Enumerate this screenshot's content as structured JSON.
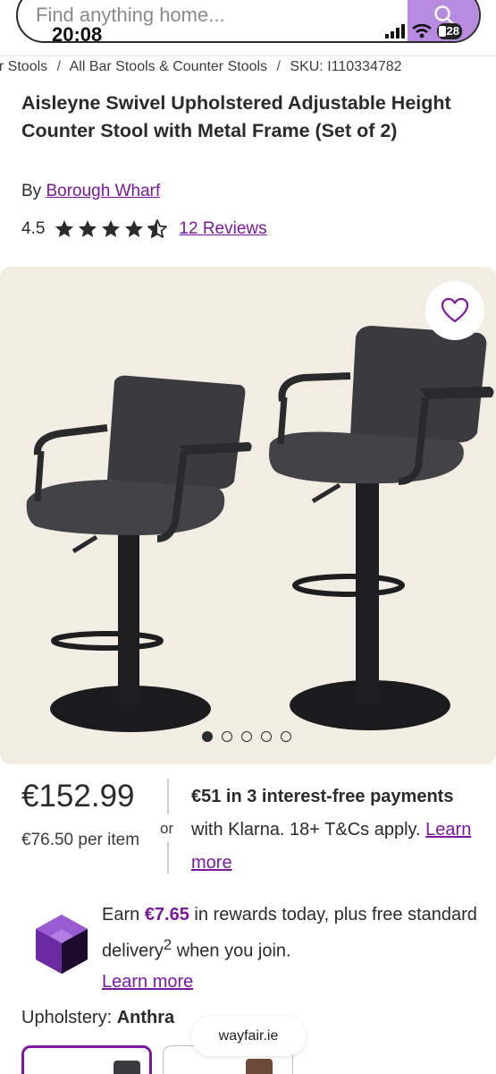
{
  "search": {
    "placeholder": "Find anything home..."
  },
  "status_bar": {
    "time": "20:08",
    "battery": "28"
  },
  "breadcrumb": {
    "items": [
      "er Stools",
      "All Bar Stools & Counter Stools",
      "SKU: I110334782"
    ],
    "separator": "/"
  },
  "product": {
    "title": "Aisleyne Swivel Upholstered Adjustable Height Counter Stool with Metal Frame (Set of 2)",
    "by_prefix": "By",
    "brand": "Borough Wharf",
    "rating": "4.5",
    "stars": 4.5,
    "reviews_link": "12 Reviews"
  },
  "gallery": {
    "image_count": 5,
    "active_index": 0
  },
  "pricing": {
    "price": "€152.99",
    "unit_price": "€76.50 per item",
    "or_label": "or",
    "klarna_bold": "€51 in 3 interest-free payments",
    "klarna_rest": " with Klarna. 18+ T&Cs apply. ",
    "klarna_link": "Learn more"
  },
  "rewards": {
    "prefix": "Earn ",
    "amount": "€7.65",
    "middle": " in rewards today, plus free standard delivery",
    "superscript": "2",
    "suffix": " when you join.",
    "link": "Learn more"
  },
  "upholstery": {
    "label": "Upholstery: ",
    "value": "Anthra"
  },
  "site_pill": "wayfair.ie",
  "colors": {
    "accent": "#7b189f",
    "search_button": "#b68be0",
    "image_bg": "#f2ece3",
    "gem": "#6a2ba2"
  }
}
